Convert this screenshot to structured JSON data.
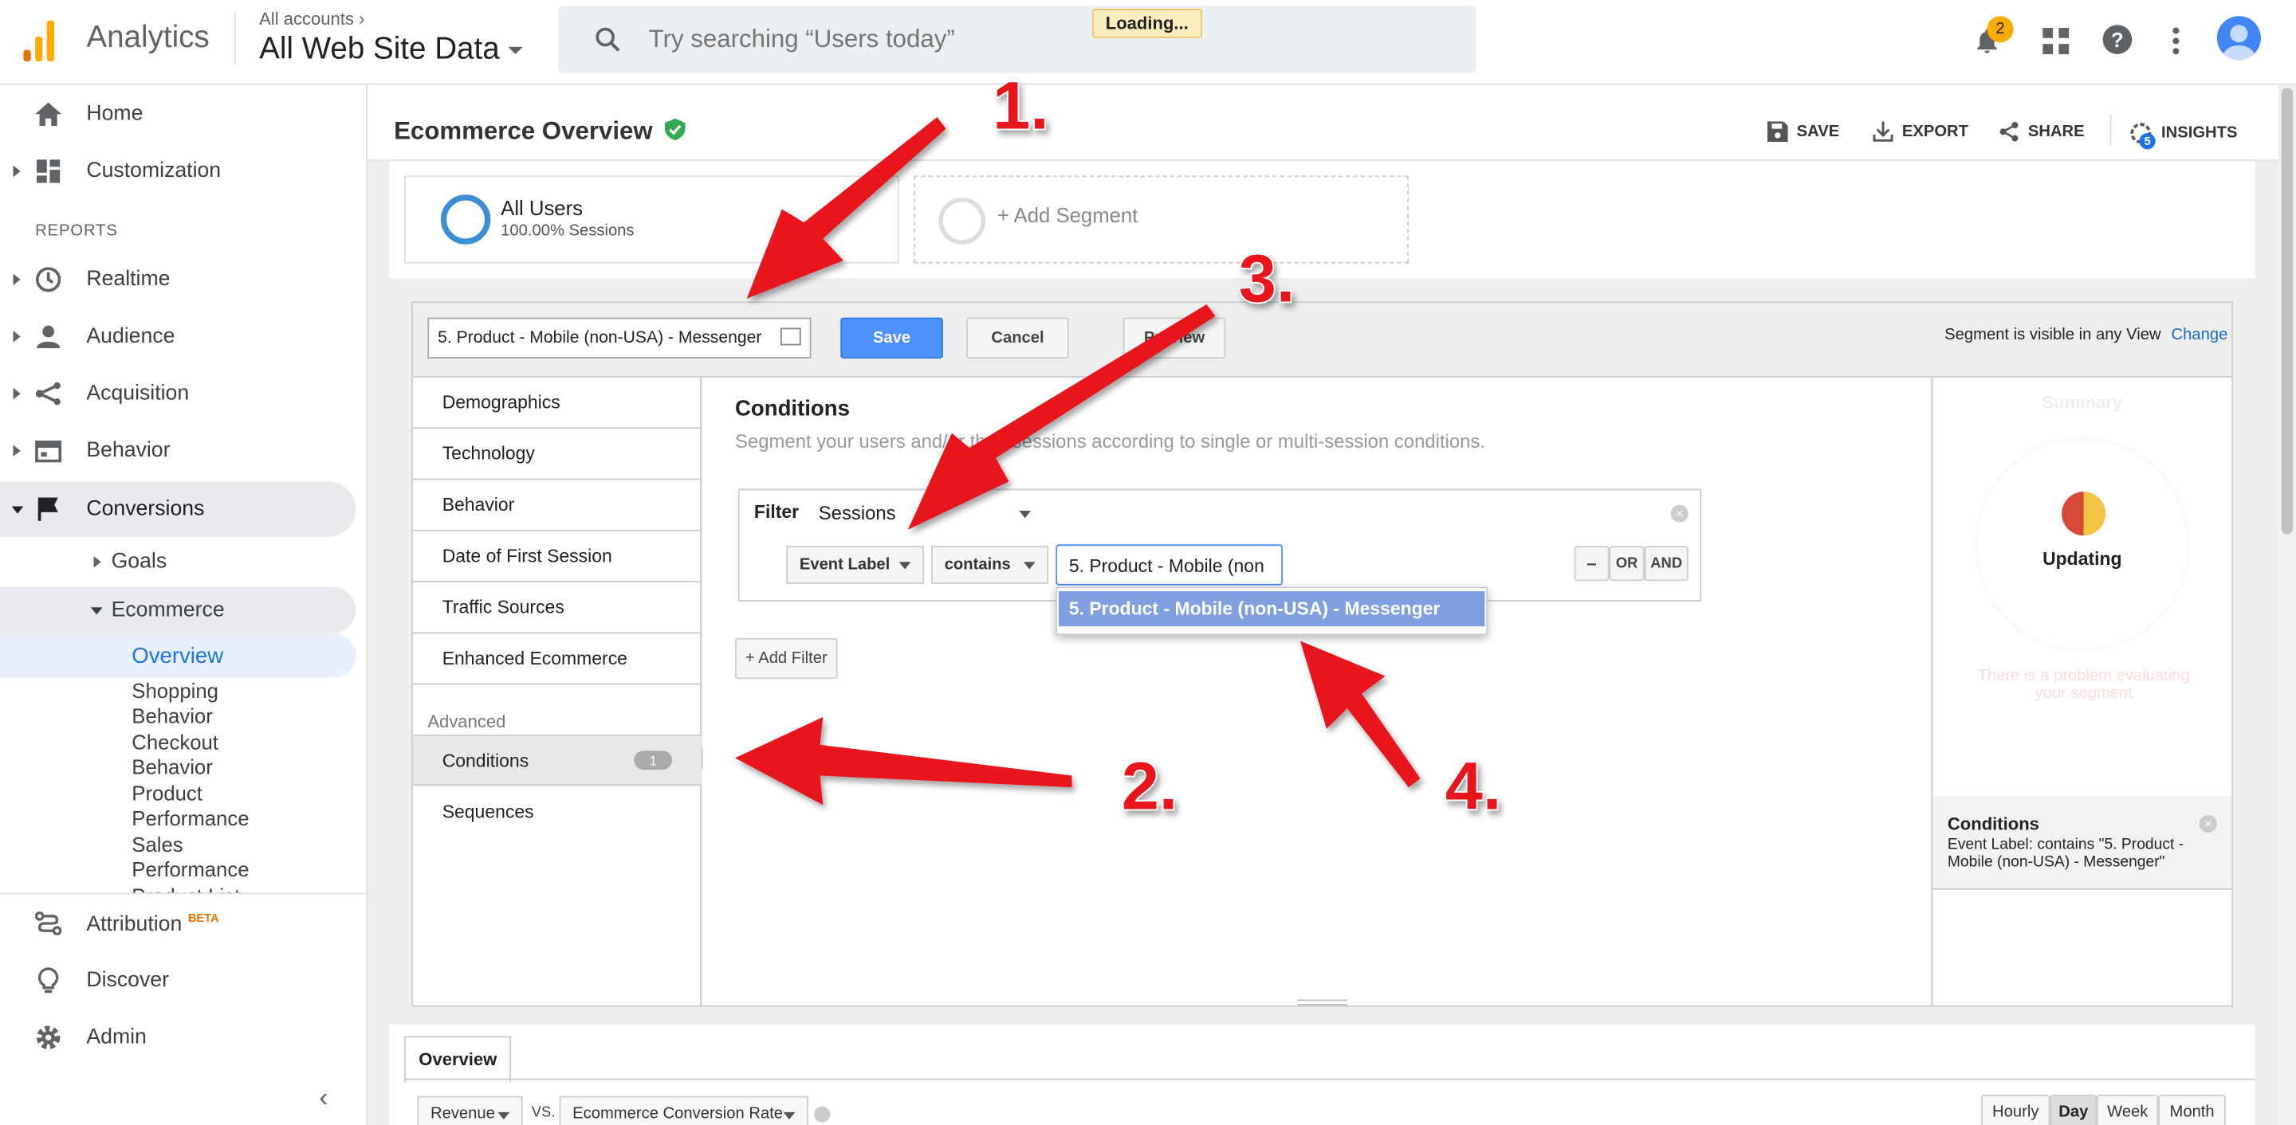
{
  "app": {
    "name": "Analytics",
    "account_label": "All accounts",
    "property": "All Web Site Data"
  },
  "search": {
    "placeholder": "Try searching “Users today”"
  },
  "loading": "Loading...",
  "notifications": {
    "count": "2"
  },
  "sidebar": {
    "home": "Home",
    "customization": "Customization",
    "reports_header": "REPORTS",
    "realtime": "Realtime",
    "audience": "Audience",
    "acquisition": "Acquisition",
    "behavior": "Behavior",
    "conversions": "Conversions",
    "goals": "Goals",
    "ecommerce": "Ecommerce",
    "overview": "Overview",
    "sub": [
      "Shopping",
      "Behavior",
      "Checkout",
      "Behavior",
      "Product",
      "Performance",
      "Sales",
      "Performance",
      "Product List"
    ],
    "attribution": "Attribution",
    "beta": "BETA",
    "discover": "Discover",
    "admin": "Admin"
  },
  "page": {
    "title": "Ecommerce Overview",
    "save": "SAVE",
    "export": "EXPORT",
    "share": "SHARE",
    "insights": "INSIGHTS",
    "insights_count": "5"
  },
  "segments": {
    "all_users": "All Users",
    "all_users_pct": "100.00% Sessions",
    "add_segment": "+ Add Segment"
  },
  "editor": {
    "segment_name": "5. Product - Mobile (non-USA) - Messenger",
    "save": "Save",
    "cancel": "Cancel",
    "preview": "Preview",
    "visibility": "Segment is visible in any View",
    "change": "Change",
    "nav": [
      "Demographics",
      "Technology",
      "Behavior",
      "Date of First Session",
      "Traffic Sources",
      "Enhanced Ecommerce"
    ],
    "advanced": "Advanced",
    "conditions": "Conditions",
    "conditions_count": "1",
    "sequences": "Sequences",
    "cond_title": "Conditions",
    "cond_desc": "Segment your users and/or their sessions according to single or multi-session conditions.",
    "filter_label": "Filter",
    "filter_scope": "Sessions",
    "dimension": "Event Label",
    "operator": "contains",
    "value": "5. Product - Mobile (non",
    "minus": "–",
    "or": "OR",
    "and": "AND",
    "suggestion": "5. Product - Mobile (non-USA) - Messenger",
    "add_filter": "+ Add Filter",
    "summary": "Summary",
    "updating": "Updating",
    "problem": "There is a problem evaluating your segment",
    "sum_conditions": "Conditions",
    "sum_detail": "Event Label: contains \"5. Product - Mobile (non-USA) - Messenger\""
  },
  "annotations": [
    "1.",
    "2.",
    "3.",
    "4."
  ],
  "bottom": {
    "tab": "Overview",
    "metric1": "Revenue",
    "vs": "VS.",
    "metric2": "Ecommerce Conversion Rate",
    "periods": [
      "Hourly",
      "Day",
      "Week",
      "Month"
    ]
  },
  "colors": {
    "accent": "#1a73e8",
    "save_btn": "#4d90fe",
    "annotation": "#e8141a",
    "suggestion": "#7f9fe0"
  }
}
